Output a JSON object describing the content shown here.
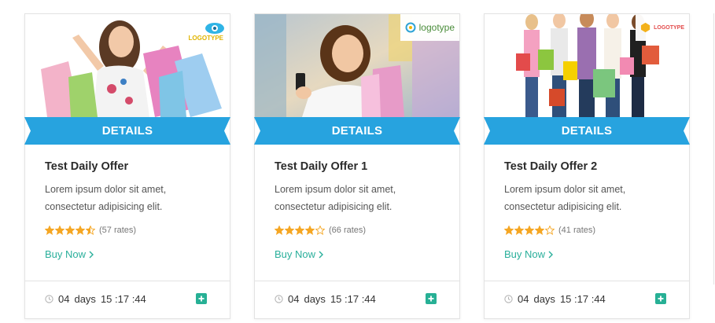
{
  "theme": {
    "ribbon_color": "#27a3df",
    "ribbon_fold_color": "#1b7fb0",
    "star_color": "#f5a623",
    "link_color": "#2aaf9b",
    "plus_color": "#27b095"
  },
  "cards": [
    {
      "logo_text": "LOGOTYPE",
      "details_label": "DETAILS",
      "title": "Test Daily Offer",
      "desc_line1": "Lorem ipsum dolor sit amet,",
      "desc_line2": "consectetur adipisicing elit.",
      "rating": 4.5,
      "rates_text": "(57 rates)",
      "buy_now": "Buy Now",
      "timer_days": "04",
      "timer_days_label": "days",
      "timer_time": "15 :17 :44"
    },
    {
      "logo_text": "logotype",
      "details_label": "DETAILS",
      "title": "Test Daily Offer 1",
      "desc_line1": "Lorem ipsum dolor sit amet,",
      "desc_line2": "consectetur adipisicing elit.",
      "rating": 4,
      "rates_text": "(66 rates)",
      "buy_now": "Buy Now",
      "timer_days": "04",
      "timer_days_label": "days",
      "timer_time": "15 :17 :44"
    },
    {
      "logo_text": "LOGOTYPE",
      "details_label": "DETAILS",
      "title": "Test Daily Offer 2",
      "desc_line1": "Lorem ipsum dolor sit amet,",
      "desc_line2": "consectetur adipisicing elit.",
      "rating": 4,
      "rates_text": "(41 rates)",
      "buy_now": "Buy Now",
      "timer_days": "04",
      "timer_days_label": "days",
      "timer_time": "15 :17 :44"
    }
  ]
}
